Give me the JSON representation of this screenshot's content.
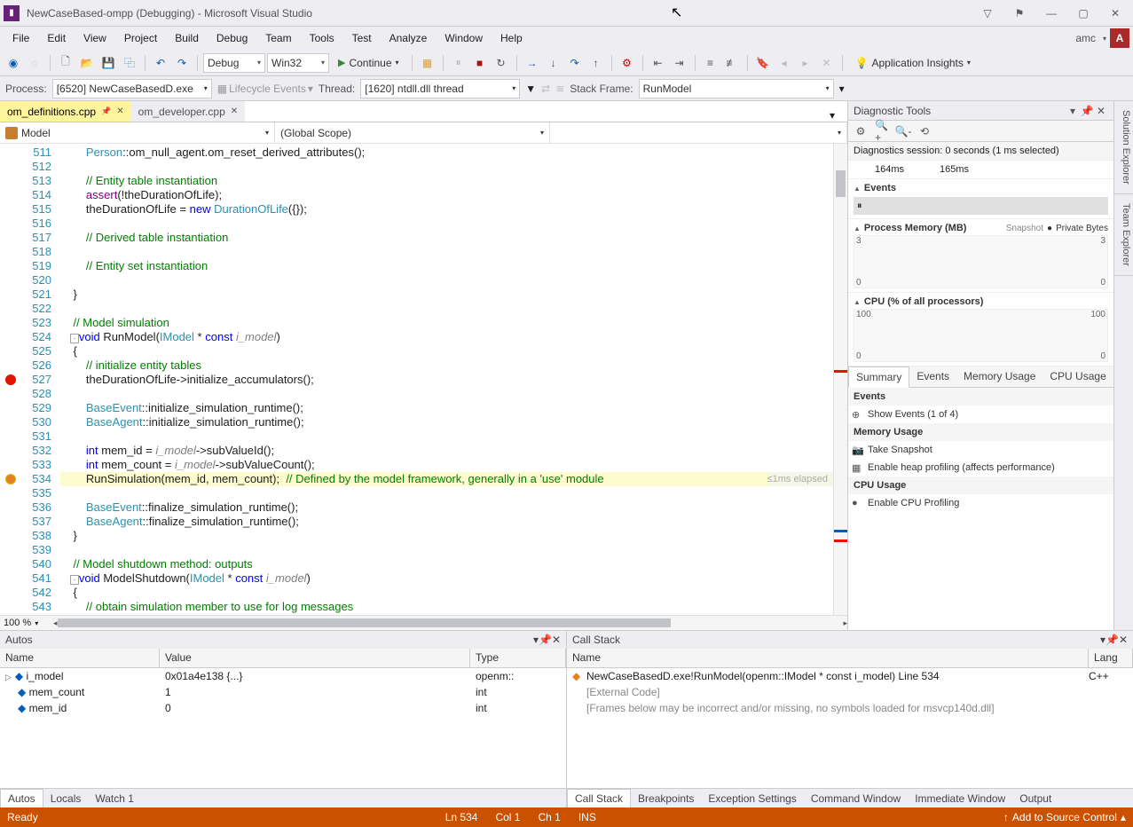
{
  "title": "NewCaseBased-ompp (Debugging) - Microsoft Visual Studio",
  "user": "amc",
  "avatar_letter": "A",
  "menubar": [
    "File",
    "Edit",
    "View",
    "Project",
    "Build",
    "Debug",
    "Team",
    "Tools",
    "Test",
    "Analyze",
    "Window",
    "Help"
  ],
  "toolbar": {
    "config": "Debug",
    "platform": "Win32",
    "continue": "Continue",
    "insights": "Application Insights"
  },
  "debugbar": {
    "process_label": "Process:",
    "process": "[6520] NewCaseBasedD.exe",
    "lifecycle": "Lifecycle Events",
    "thread_label": "Thread:",
    "thread": "[1620] ntdll.dll thread",
    "stack_label": "Stack Frame:",
    "stack": "RunModel"
  },
  "tabs": [
    {
      "label": "om_definitions.cpp",
      "active": true,
      "pinned": true
    },
    {
      "label": "om_developer.cpp",
      "active": false
    }
  ],
  "breadcrumb": {
    "scope1": "Model",
    "scope2": "(Global Scope)",
    "scope3": ""
  },
  "zoom": "100 %",
  "code_lines_start": 511,
  "code_lines": [
    "        Person::om_null_agent.om_reset_derived_attributes();",
    "",
    "        // Entity table instantiation",
    "        assert(!theDurationOfLife);",
    "        theDurationOfLife = new DurationOfLife({});",
    "",
    "        // Derived table instantiation",
    "",
    "        // Entity set instantiation",
    "",
    "    }",
    "",
    "    // Model simulation",
    "   ⊟void RunModel(IModel * const i_model)",
    "    {",
    "        // initialize entity tables",
    "        theDurationOfLife->initialize_accumulators();",
    "",
    "        BaseEvent::initialize_simulation_runtime();",
    "        BaseAgent::initialize_simulation_runtime();",
    "",
    "        int mem_id = i_model->subValueId();",
    "        int mem_count = i_model->subValueCount();",
    "        RunSimulation(mem_id, mem_count);  // Defined by the model framework, generally in a 'use' module",
    "",
    "        BaseEvent::finalize_simulation_runtime();",
    "        BaseAgent::finalize_simulation_runtime();",
    "    }",
    "",
    "    // Model shutdown method: outputs",
    "   ⊟void ModelShutdown(IModel * const i_model)",
    "    {",
    "        // obtain simulation member to use for log messages"
  ],
  "elapsed_label": "≤1ms elapsed",
  "breakpoint_lines": [
    527
  ],
  "current_line": 534,
  "diag": {
    "title": "Diagnostic Tools",
    "session": "Diagnostics session: 0 seconds (1 ms selected)",
    "timeline_ticks": [
      "164ms",
      "165ms"
    ],
    "events_hdr": "Events",
    "mem_hdr": "Process Memory (MB)",
    "mem_legend1": "Snapshot",
    "mem_legend2": "Private Bytes",
    "mem_y_top": "3",
    "mem_y_bot": "0",
    "cpu_hdr": "CPU (% of all processors)",
    "cpu_y_top": "100",
    "cpu_y_bot": "0",
    "tabs": [
      "Summary",
      "Events",
      "Memory Usage",
      "CPU Usage"
    ],
    "events_cat": "Events",
    "show_events": "Show Events (1 of 4)",
    "mem_cat": "Memory Usage",
    "take_snapshot": "Take Snapshot",
    "heap_profiling": "Enable heap profiling (affects performance)",
    "cpu_cat": "CPU Usage",
    "cpu_profiling": "Enable CPU Profiling"
  },
  "side_tabs": [
    "Solution Explorer",
    "Team Explorer"
  ],
  "autos": {
    "title": "Autos",
    "cols": [
      "Name",
      "Value",
      "Type"
    ],
    "rows": [
      {
        "name": "i_model",
        "value": "0x01a4e138 {...}",
        "type": "openm::",
        "expandable": true,
        "icon": "var"
      },
      {
        "name": "mem_count",
        "value": "1",
        "type": "int"
      },
      {
        "name": "mem_id",
        "value": "0",
        "type": "int"
      }
    ],
    "footer": [
      "Autos",
      "Locals",
      "Watch 1"
    ]
  },
  "callstack": {
    "title": "Call Stack",
    "cols": [
      "Name",
      "Lang"
    ],
    "rows": [
      {
        "name": "NewCaseBasedD.exe!RunModel(openm::IModel * const i_model) Line 534",
        "lang": "C++",
        "current": true
      },
      {
        "name": "[External Code]",
        "lang": ""
      },
      {
        "name": "[Frames below may be incorrect and/or missing, no symbols loaded for msvcp140d.dll]",
        "lang": ""
      }
    ],
    "footer": [
      "Call Stack",
      "Breakpoints",
      "Exception Settings",
      "Command Window",
      "Immediate Window",
      "Output"
    ]
  },
  "status": {
    "ready": "Ready",
    "ln": "Ln 534",
    "col": "Col 1",
    "ch": "Ch 1",
    "ins": "INS",
    "src_ctrl": "Add to Source Control"
  }
}
